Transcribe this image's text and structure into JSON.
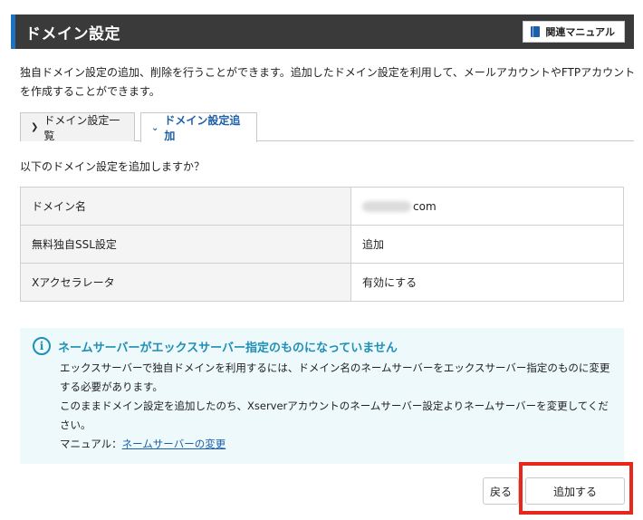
{
  "header": {
    "title": "ドメイン設定",
    "manual_label": "関連マニュアル"
  },
  "description": "独自ドメイン設定の追加、削除を行うことができます。追加したドメイン設定を利用して、メールアカウントやFTPアカウントを作成することができます。",
  "tabs": [
    {
      "label": "ドメイン設定一覧",
      "active": false
    },
    {
      "label": "ドメイン設定追加",
      "active": true
    }
  ],
  "confirm_text": "以下のドメイン設定を追加しますか？",
  "rows": [
    {
      "label": "ドメイン名",
      "value": "com"
    },
    {
      "label": "無料独自SSL設定",
      "value": "追加"
    },
    {
      "label": "Xアクセラレータ",
      "value": "有効にする"
    }
  ],
  "notice": {
    "title": "ネームサーバーがエックスサーバー指定のものになっていません",
    "line1": "エックスサーバーで独自ドメインを利用するには、ドメイン名のネームサーバーをエックスサーバー指定のものに変更する必要があります。",
    "line2": "このままドメイン設定を追加したのち、Xserverアカウントのネームサーバー設定よりネームサーバーを変更してください。",
    "manual_prefix": "マニュアル：",
    "manual_link": "ネームサーバーの変更"
  },
  "buttons": {
    "back": "戻る",
    "submit": "追加する"
  },
  "colors": {
    "accent": "#1e73be",
    "header_bg": "#3a3a3a",
    "notice_bg": "#eef9fc",
    "notice_title": "#1f8fb5",
    "highlight": "#e8261a"
  },
  "icons": {
    "manual": "book-icon",
    "notice": "info-icon",
    "tab_collapsed": "chevron-right-icon",
    "tab_expanded": "chevron-down-icon"
  }
}
